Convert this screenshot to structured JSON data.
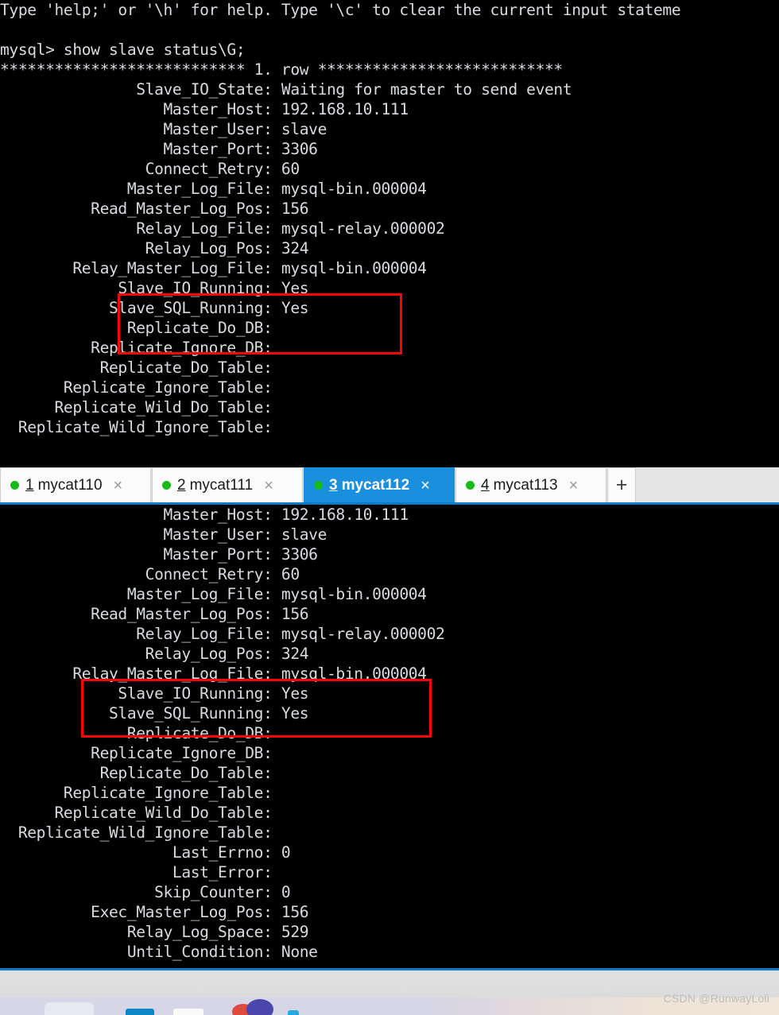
{
  "terminal_top": {
    "lines": [
      "Type 'help;' or '\\h' for help. Type '\\c' to clear the current input stateme",
      "",
      "mysql> show slave status\\G;",
      "*************************** 1. row ***************************",
      "               Slave_IO_State: Waiting for master to send event",
      "                  Master_Host: 192.168.10.111",
      "                  Master_User: slave",
      "                  Master_Port: 3306",
      "                Connect_Retry: 60",
      "              Master_Log_File: mysql-bin.000004",
      "          Read_Master_Log_Pos: 156",
      "               Relay_Log_File: mysql-relay.000002",
      "                Relay_Log_Pos: 324",
      "        Relay_Master_Log_File: mysql-bin.000004",
      "             Slave_IO_Running: Yes",
      "            Slave_SQL_Running: Yes",
      "              Replicate_Do_DB:",
      "          Replicate_Ignore_DB:",
      "           Replicate_Do_Table:",
      "       Replicate_Ignore_Table:",
      "      Replicate_Wild_Do_Table:",
      "  Replicate_Wild_Ignore_Table:"
    ]
  },
  "terminal_bottom": {
    "lines": [
      "                  Master_Host: 192.168.10.111",
      "                  Master_User: slave",
      "                  Master_Port: 3306",
      "                Connect_Retry: 60",
      "              Master_Log_File: mysql-bin.000004",
      "          Read_Master_Log_Pos: 156",
      "               Relay_Log_File: mysql-relay.000002",
      "                Relay_Log_Pos: 324",
      "        Relay_Master_Log_File: mysql-bin.000004",
      "             Slave_IO_Running: Yes",
      "            Slave_SQL_Running: Yes",
      "              Replicate_Do_DB:",
      "          Replicate_Ignore_DB:",
      "           Replicate_Do_Table:",
      "       Replicate_Ignore_Table:",
      "      Replicate_Wild_Do_Table:",
      "  Replicate_Wild_Ignore_Table:",
      "                   Last_Errno: 0",
      "                   Last_Error:",
      "                 Skip_Counter: 0",
      "          Exec_Master_Log_Pos: 156",
      "              Relay_Log_Space: 529",
      "              Until_Condition: None"
    ]
  },
  "tabs": {
    "items": [
      {
        "number": "1",
        "title": "mycat110",
        "status": "connected",
        "active": false,
        "close": "×"
      },
      {
        "number": "2",
        "title": "mycat111",
        "status": "connected",
        "active": false,
        "close": "×"
      },
      {
        "number": "3",
        "title": "mycat112",
        "status": "connected",
        "active": true,
        "close": "×"
      },
      {
        "number": "4",
        "title": "mycat113",
        "status": "connected",
        "active": false,
        "close": "×"
      }
    ],
    "new_tab_label": "+"
  },
  "annotations": {
    "highlight_color": "#fb0406",
    "boxes": [
      {
        "id": "top",
        "lines": [
          "Slave_IO_Running: Yes",
          "Slave_SQL_Running: Yes",
          "Replicate_Do_DB:"
        ]
      },
      {
        "id": "bottom",
        "lines": [
          "Slave_IO_Running: Yes",
          "Slave_SQL_Running: Yes",
          "Replicate_Do_DB:"
        ]
      }
    ]
  },
  "colors": {
    "terminal_bg": "#000000",
    "terminal_fg": "#d8dbe0",
    "tab_active_bg": "#1a8fdd",
    "tab_inactive_bg": "#fbfbfb",
    "status_dot": "#17bb17",
    "accent_rule": "#0d7bc4"
  },
  "watermark": {
    "text": "CSDN @RunwayLoli"
  }
}
